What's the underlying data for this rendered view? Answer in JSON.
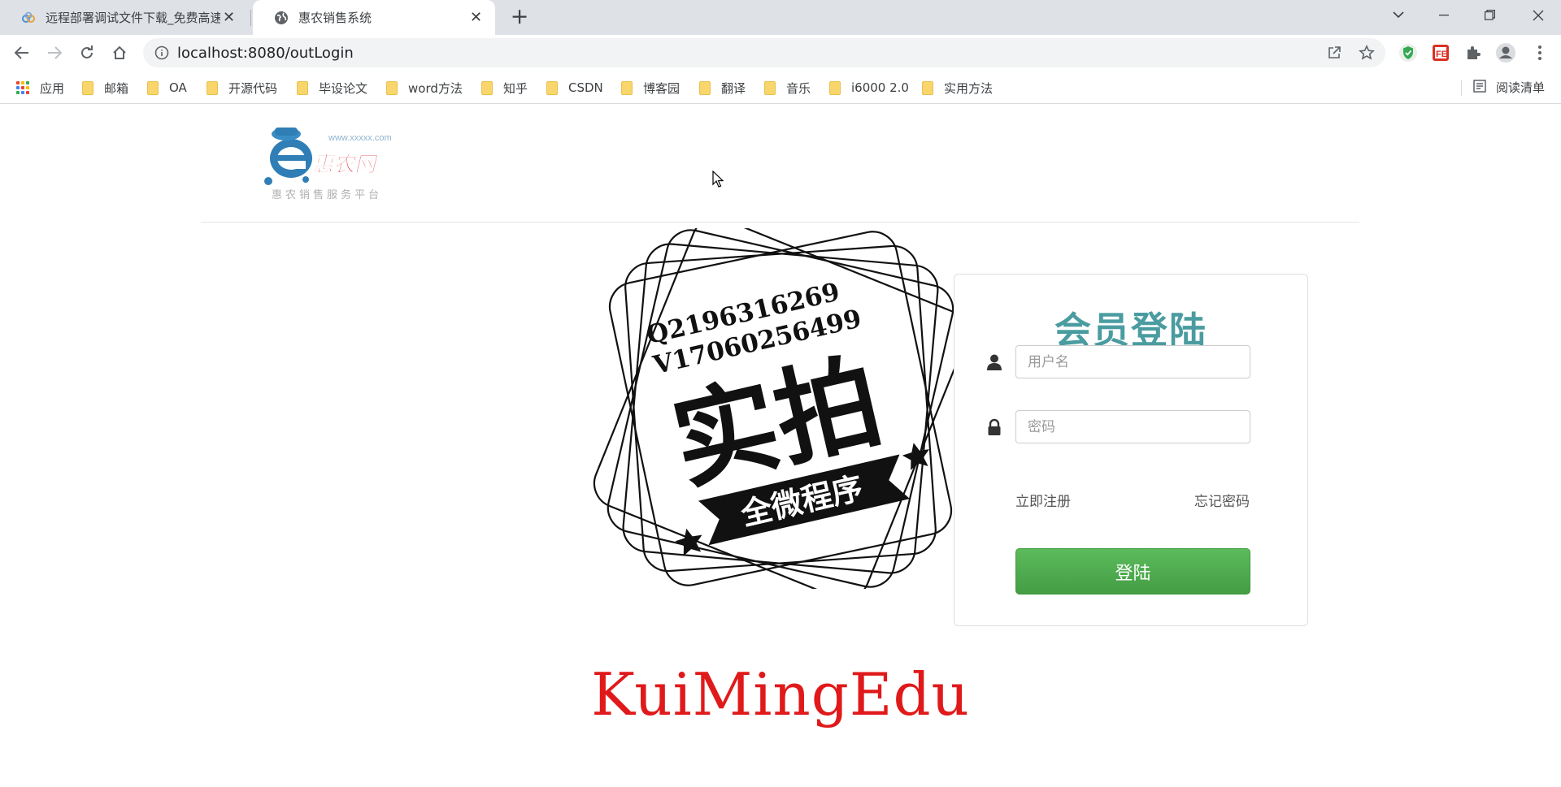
{
  "browser": {
    "tabs": [
      {
        "title": "远程部署调试文件下载_免费高速",
        "active": false
      },
      {
        "title": "惠农销售系统",
        "active": true
      }
    ],
    "url": "localhost:8080/outLogin",
    "bookmarks": [
      {
        "label": "应用",
        "icon": "apps-grid-icon"
      },
      {
        "label": "邮箱",
        "icon": "folder-icon"
      },
      {
        "label": "OA",
        "icon": "folder-icon"
      },
      {
        "label": "开源代码",
        "icon": "folder-icon"
      },
      {
        "label": "毕设论文",
        "icon": "folder-icon"
      },
      {
        "label": "word方法",
        "icon": "folder-icon"
      },
      {
        "label": "知乎",
        "icon": "folder-icon"
      },
      {
        "label": "CSDN",
        "icon": "folder-icon"
      },
      {
        "label": "博客园",
        "icon": "folder-icon"
      },
      {
        "label": "翻译",
        "icon": "folder-icon"
      },
      {
        "label": "音乐",
        "icon": "folder-icon"
      },
      {
        "label": "i6000 2.0",
        "icon": "folder-icon"
      },
      {
        "label": "实用方法",
        "icon": "folder-icon"
      }
    ],
    "reading_list": "阅读清单"
  },
  "header": {
    "logo": {
      "url_text": "www.xxxxx.com",
      "brand": "惠农网",
      "slogan": "惠农销售服务平台"
    }
  },
  "stamp": {
    "line1": "Q2196316269",
    "line2": "V17060256499",
    "main": "实拍",
    "banner": "全微程序"
  },
  "login": {
    "title": "会员登陆",
    "username_placeholder": "用户名",
    "password_placeholder": "密码",
    "register_link": "立即注册",
    "forgot_link": "忘记密码",
    "submit_label": "登陆"
  },
  "watermark": "KuiMingEdu",
  "colors": {
    "title_teal": "#4a9ca0",
    "button_green": "#4cae4c",
    "watermark_red": "#e0191a",
    "logo_red": "#d8242b",
    "logo_blue": "#2f7fb6"
  }
}
